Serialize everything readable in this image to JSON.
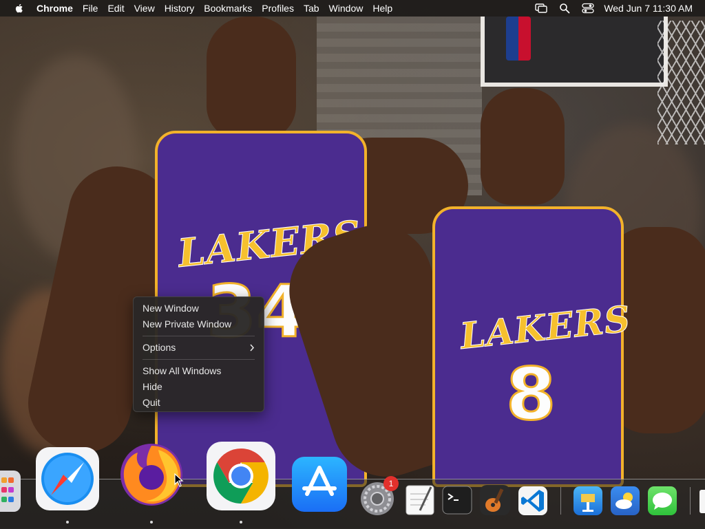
{
  "menubar": {
    "apple_icon": "apple-logo-icon",
    "app_name": "Chrome",
    "menus": [
      "File",
      "Edit",
      "View",
      "History",
      "Bookmarks",
      "Profiles",
      "Tab",
      "Window",
      "Help"
    ],
    "status_icons": [
      "screen-mirroring-icon",
      "search-icon",
      "control-center-icon"
    ],
    "clock": "Wed Jun 7  11:30 AM"
  },
  "context_menu": {
    "items": [
      {
        "label": "New Window"
      },
      {
        "label": "New Private Window"
      },
      {
        "label": "Options",
        "submenu": true
      },
      {
        "label": "Show All Windows"
      },
      {
        "label": "Hide"
      },
      {
        "label": "Quit"
      }
    ]
  },
  "wallpaper": {
    "jersey_left": {
      "team": "LAKERS",
      "number": "34"
    },
    "jersey_right": {
      "team": "LAKERS",
      "number": "8"
    }
  },
  "dock": {
    "apps": [
      {
        "name": "Launchpad",
        "icon": "launchpad-icon",
        "running": false
      },
      {
        "name": "Safari",
        "icon": "safari-icon",
        "running": true
      },
      {
        "name": "Firefox",
        "icon": "firefox-icon",
        "running": true
      },
      {
        "name": "Google Chrome",
        "icon": "chrome-icon",
        "running": true
      },
      {
        "name": "App Store",
        "icon": "app-store-icon",
        "running": false
      },
      {
        "name": "System Preferences",
        "icon": "system-preferences-icon",
        "running": false,
        "badge": "1"
      },
      {
        "name": "TextEdit",
        "icon": "textedit-icon",
        "running": false
      },
      {
        "name": "Terminal",
        "icon": "terminal-icon",
        "running": false
      },
      {
        "name": "GarageBand",
        "icon": "garageband-icon",
        "running": false
      },
      {
        "name": "Visual Studio Code",
        "icon": "vscode-icon",
        "running": false
      },
      {
        "name": "Keynote",
        "icon": "keynote-icon",
        "running": false
      },
      {
        "name": "Weather",
        "icon": "weather-icon",
        "running": false
      },
      {
        "name": "Messages",
        "icon": "messages-icon",
        "running": false
      }
    ]
  },
  "colors": {
    "lakers_purple": "#4b2c8f",
    "lakers_gold": "#f2b22b",
    "badge_red": "#e2302c"
  }
}
